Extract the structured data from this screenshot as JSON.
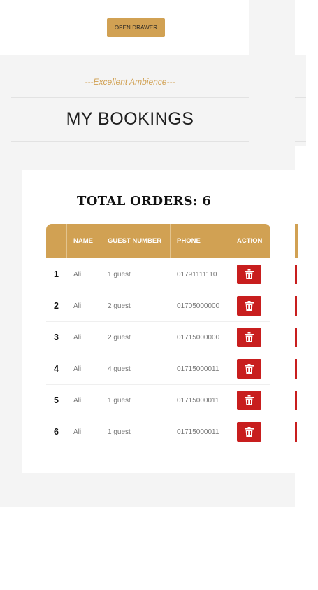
{
  "drawer": {
    "button_label": "OPEN DRAWER"
  },
  "header": {
    "tagline": "---Excellent Ambience---",
    "title": "MY BOOKINGS"
  },
  "summary": {
    "total_label": "TOTAL ORDERS: 6"
  },
  "table": {
    "columns": [
      "",
      "NAME",
      "GUEST NUMBER",
      "PHONE",
      "ACTION"
    ],
    "rows": [
      {
        "index": "1",
        "name": "Ali",
        "guests": "1 guest",
        "phone": "01791111110"
      },
      {
        "index": "2",
        "name": "Ali",
        "guests": "2 guest",
        "phone": "01705000000"
      },
      {
        "index": "3",
        "name": "Ali",
        "guests": "2 guest",
        "phone": "01715000000"
      },
      {
        "index": "4",
        "name": "Ali",
        "guests": "4 guest",
        "phone": "01715000011"
      },
      {
        "index": "5",
        "name": "Ali",
        "guests": "1 guest",
        "phone": "01715000011"
      },
      {
        "index": "6",
        "name": "Ali",
        "guests": "1 guest",
        "phone": "01715000011"
      }
    ],
    "action_icon": "trash-icon"
  },
  "colors": {
    "accent": "#d1a153",
    "danger": "#c81e1e",
    "background": "#f4f4f4"
  }
}
